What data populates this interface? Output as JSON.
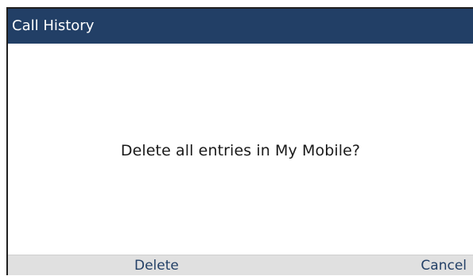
{
  "window": {
    "title": "Call History"
  },
  "dialog": {
    "message": "Delete all entries in My Mobile?"
  },
  "softkeys": {
    "left_label": "Delete",
    "right_label": "Cancel"
  },
  "colors": {
    "titlebar_bg": "#223f66",
    "titlebar_text": "#ffffff",
    "softkey_bar_bg": "#e0e0e0",
    "softkey_text": "#223f66"
  }
}
